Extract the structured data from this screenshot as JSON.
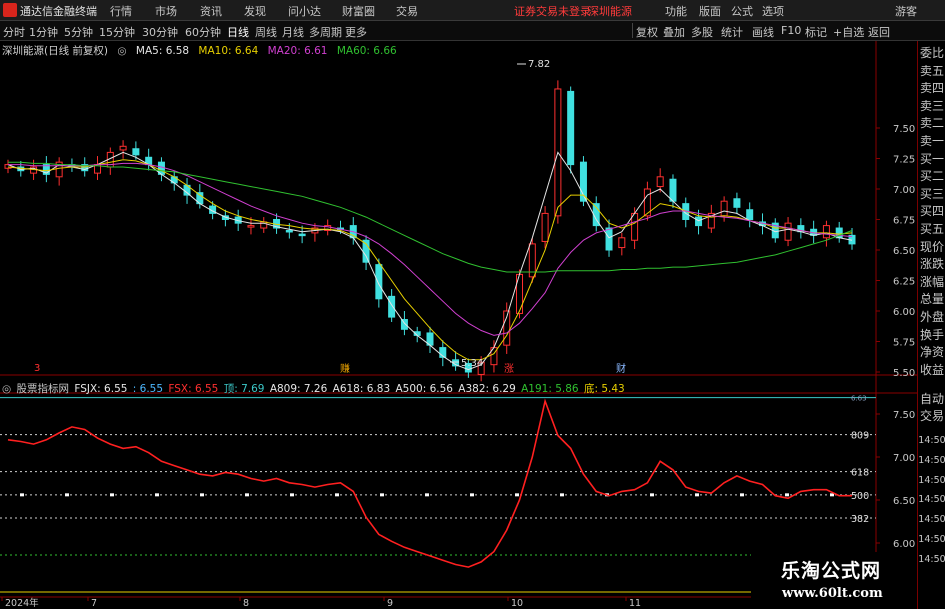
{
  "menubar": {
    "app_title": "通达信金融终端",
    "items": [
      "行情",
      "市场",
      "资讯",
      "发现",
      "问小达",
      "财富圈",
      "交易"
    ],
    "notice": "证券交易未登录",
    "notice_stock": "深圳能源",
    "right_items": [
      "功能",
      "版面",
      "公式",
      "选项"
    ],
    "guest": "游客",
    "colors": {
      "notice": "#ff3b3b"
    }
  },
  "toolbar": {
    "periods": [
      "分时",
      "1分钟",
      "5分钟",
      "15分钟",
      "30分钟",
      "60分钟",
      "日线",
      "周线",
      "月线",
      "多周期",
      "更多"
    ],
    "active_period": "日线",
    "right_buttons": [
      "复权",
      "叠加",
      "多股",
      "统计",
      "画线",
      "F10",
      "标记",
      "+自选",
      "返回"
    ]
  },
  "main_chart": {
    "stock_label": "深圳能源(日线 前复权)",
    "ma": [
      {
        "label": "MA5: 6.58",
        "color": "#e6e6e6"
      },
      {
        "label": "MA10: 6.64",
        "color": "#e8d000"
      },
      {
        "label": "MA20: 6.61",
        "color": "#d040d0"
      },
      {
        "label": "MA60: 6.66",
        "color": "#30c030"
      }
    ],
    "high_label": "7.82",
    "low_label": "5.34",
    "axis_ticks": [
      "7.50",
      "7.25",
      "7.00",
      "6.75",
      "6.50",
      "6.25",
      "6.00",
      "5.75",
      "5.50"
    ],
    "markers": [
      "3",
      "赚",
      "涨",
      "财"
    ]
  },
  "indicator": {
    "legend": [
      {
        "text": "股票指标网",
        "color": "#c8c8c8"
      },
      {
        "text": "FSJX: 6.55",
        "color": "#e6e6e6"
      },
      {
        "text": ": 6.55",
        "color": "#4db8ff"
      },
      {
        "text": "FSX: 6.55",
        "color": "#ff3030"
      },
      {
        "text": "顶: 7.69",
        "color": "#3cc8c8"
      },
      {
        "text": "A809: 7.26",
        "color": "#e6e6e6"
      },
      {
        "text": "A618: 6.83",
        "color": "#e6e6e6"
      },
      {
        "text": "A500: 6.56",
        "color": "#e6e6e6"
      },
      {
        "text": "A382: 6.29",
        "color": "#e6e6e6"
      },
      {
        "text": "A191: 5.86",
        "color": "#30c030"
      },
      {
        "text": "底: 5.43",
        "color": "#e8d000"
      }
    ],
    "level_labels": [
      "809",
      "618",
      "500",
      "382"
    ],
    "axis_ticks": [
      "7.50",
      "7.00",
      "6.50",
      "6.00"
    ],
    "right_small": "6.63"
  },
  "date_axis": {
    "labels": [
      "2024年",
      "7",
      "8",
      "9",
      "10",
      "11"
    ]
  },
  "sidebar": {
    "items": [
      "委比",
      "卖五",
      "卖四",
      "卖三",
      "卖二",
      "卖一",
      "买一",
      "买二",
      "买三",
      "买四",
      "买五",
      "现价",
      "涨跌",
      "涨幅",
      "总量",
      "外盘",
      "换手",
      "净资",
      "收益",
      "自动",
      "交易",
      "14:50",
      "14:50",
      "14:50",
      "14:50",
      "14:50",
      "14:50",
      "14:50"
    ]
  },
  "watermark": {
    "title": "乐淘公式网",
    "url": "www.60lt.com"
  },
  "chart_data": {
    "type": "line",
    "title": "深圳能源(日线 前复权)",
    "ylim": [
      5.25,
      7.95
    ],
    "candles_close": [
      7.2,
      7.15,
      7.18,
      7.12,
      7.22,
      7.18,
      7.15,
      7.2,
      7.3,
      7.35,
      7.28,
      7.2,
      7.12,
      7.05,
      6.95,
      6.88,
      6.8,
      6.75,
      6.72,
      6.7,
      6.73,
      6.68,
      6.65,
      6.62,
      6.68,
      6.7,
      6.68,
      6.6,
      6.4,
      6.1,
      5.95,
      5.85,
      5.8,
      5.72,
      5.62,
      5.55,
      5.5,
      5.58,
      5.7,
      6.0,
      6.3,
      6.55,
      6.8,
      7.82,
      7.2,
      6.9,
      6.7,
      6.5,
      6.6,
      6.8,
      7.0,
      7.1,
      6.9,
      6.75,
      6.7,
      6.8,
      6.9,
      6.85,
      6.75,
      6.7,
      6.6,
      6.72,
      6.65,
      6.62,
      6.7,
      6.6,
      6.55
    ],
    "series": [
      {
        "name": "MA5",
        "values": [
          7.2,
          7.16,
          7.17,
          7.13,
          7.2,
          7.18,
          7.16,
          7.2,
          7.25,
          7.3,
          7.26,
          7.2,
          7.12,
          7.05,
          6.97,
          6.88,
          6.82,
          6.77,
          6.74,
          6.72,
          6.72,
          6.69,
          6.67,
          6.65,
          6.66,
          6.67,
          6.65,
          6.6,
          6.45,
          6.22,
          6.05,
          5.9,
          5.8,
          5.72,
          5.63,
          5.56,
          5.52,
          5.56,
          5.7,
          5.95,
          6.3,
          6.6,
          6.95,
          7.3,
          7.15,
          6.95,
          6.75,
          6.6,
          6.65,
          6.8,
          6.95,
          7.0,
          6.9,
          6.8,
          6.74,
          6.78,
          6.82,
          6.8,
          6.74,
          6.7,
          6.65,
          6.67,
          6.65,
          6.62,
          6.64,
          6.6,
          6.58
        ]
      },
      {
        "name": "MA10",
        "values": [
          7.18,
          7.17,
          7.16,
          7.15,
          7.17,
          7.18,
          7.18,
          7.2,
          7.22,
          7.24,
          7.23,
          7.2,
          7.15,
          7.1,
          7.03,
          6.95,
          6.88,
          6.82,
          6.78,
          6.75,
          6.73,
          6.71,
          6.7,
          6.68,
          6.67,
          6.67,
          6.66,
          6.62,
          6.55,
          6.4,
          6.25,
          6.1,
          5.98,
          5.86,
          5.75,
          5.66,
          5.6,
          5.6,
          5.65,
          5.8,
          6.0,
          6.25,
          6.5,
          6.85,
          6.95,
          6.95,
          6.85,
          6.72,
          6.68,
          6.72,
          6.8,
          6.88,
          6.86,
          6.82,
          6.78,
          6.77,
          6.78,
          6.77,
          6.74,
          6.72,
          6.68,
          6.68,
          6.66,
          6.64,
          6.64,
          6.63,
          6.64
        ]
      },
      {
        "name": "MA20",
        "values": [
          7.2,
          7.2,
          7.19,
          7.19,
          7.19,
          7.19,
          7.19,
          7.2,
          7.2,
          7.21,
          7.21,
          7.2,
          7.18,
          7.15,
          7.11,
          7.06,
          7.01,
          6.96,
          6.91,
          6.86,
          6.82,
          6.78,
          6.75,
          6.72,
          6.7,
          6.69,
          6.67,
          6.65,
          6.61,
          6.55,
          6.47,
          6.38,
          6.28,
          6.18,
          6.08,
          5.98,
          5.9,
          5.84,
          5.8,
          5.82,
          5.9,
          6.02,
          6.15,
          6.35,
          6.48,
          6.58,
          6.64,
          6.67,
          6.7,
          6.73,
          6.76,
          6.8,
          6.82,
          6.82,
          6.8,
          6.78,
          6.77,
          6.76,
          6.74,
          6.72,
          6.7,
          6.68,
          6.66,
          6.64,
          6.63,
          6.62,
          6.61
        ]
      },
      {
        "name": "MA60",
        "values": [
          7.22,
          7.22,
          7.21,
          7.21,
          7.2,
          7.2,
          7.19,
          7.19,
          7.18,
          7.18,
          7.17,
          7.16,
          7.15,
          7.14,
          7.12,
          7.1,
          7.08,
          7.06,
          7.04,
          7.02,
          7.0,
          6.98,
          6.96,
          6.94,
          6.91,
          6.88,
          6.85,
          6.81,
          6.77,
          6.72,
          6.67,
          6.62,
          6.57,
          6.52,
          6.47,
          6.43,
          6.39,
          6.36,
          6.34,
          6.32,
          6.32,
          6.32,
          6.32,
          6.33,
          6.33,
          6.33,
          6.33,
          6.33,
          6.34,
          6.34,
          6.35,
          6.35,
          6.36,
          6.36,
          6.37,
          6.38,
          6.39,
          6.4,
          6.42,
          6.44,
          6.46,
          6.49,
          6.52,
          6.55,
          6.58,
          6.62,
          6.66
        ]
      },
      {
        "name": "FSX",
        "values": [
          7.2,
          7.18,
          7.15,
          7.2,
          7.28,
          7.35,
          7.32,
          7.22,
          7.15,
          7.1,
          7.12,
          7.05,
          6.95,
          6.9,
          6.85,
          6.8,
          6.78,
          6.82,
          6.8,
          6.75,
          6.72,
          6.75,
          6.7,
          6.68,
          6.65,
          6.68,
          6.7,
          6.6,
          6.3,
          6.1,
          6.02,
          5.95,
          5.9,
          5.85,
          5.8,
          5.75,
          5.72,
          5.78,
          5.9,
          6.15,
          6.5,
          7.0,
          7.65,
          7.25,
          7.1,
          6.8,
          6.6,
          6.55,
          6.6,
          6.62,
          6.7,
          6.95,
          6.85,
          6.65,
          6.6,
          6.58,
          6.7,
          6.78,
          6.72,
          6.68,
          6.55,
          6.52,
          6.6,
          6.62,
          6.62,
          6.55,
          6.55
        ]
      }
    ]
  }
}
